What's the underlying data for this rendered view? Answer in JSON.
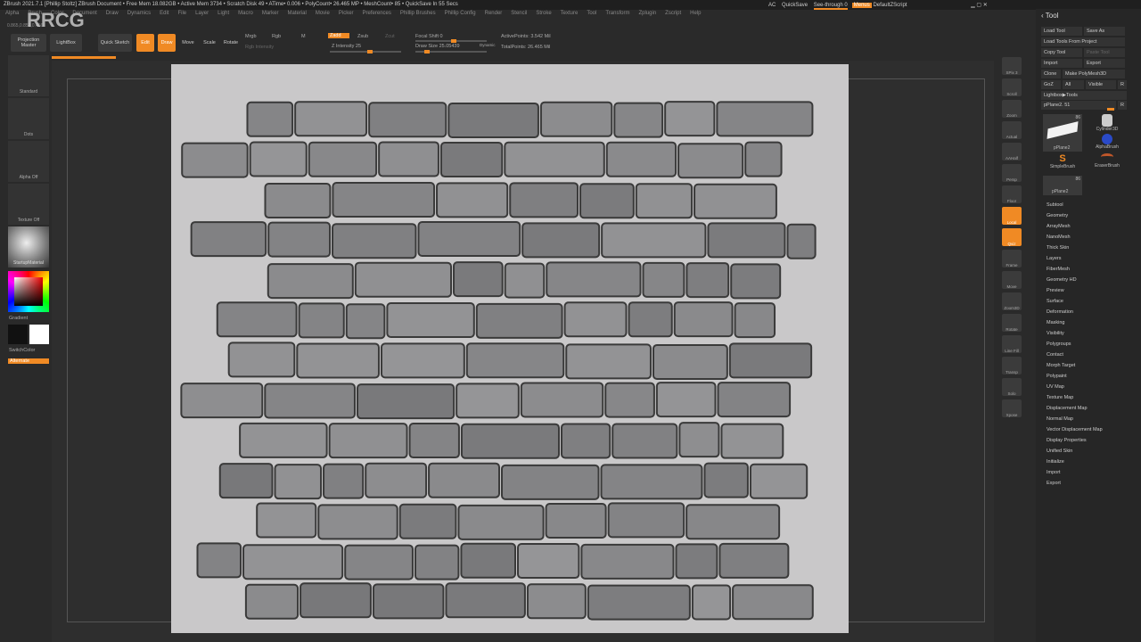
{
  "titlebar": {
    "text": "ZBrush 2021.7.1 [Phillip Stoltz]   ZBrush Document     • Free Mem 18.082GB • Active Mem 3734 • Scratch Disk 49 •  ATime• 0.006 • PolyCount• 26.465 MP  • MeshCount• 85  • QuickSave In 55 Secs",
    "right": {
      "ac": "AC",
      "quicksave": "QuickSave",
      "see_through": "See-through 0",
      "menus": "Menus",
      "script": "DefaultZScript"
    }
  },
  "menu": [
    "Alpha",
    "Brush",
    "Color",
    "Document",
    "Draw",
    "Dynamics",
    "Edit",
    "File",
    "Layer",
    "Light",
    "Macro",
    "Marker",
    "Material",
    "Movie",
    "Picker",
    "Preferences",
    "Phillip Brushes",
    "Phillip Config",
    "Render",
    "Stencil",
    "Stroke",
    "Texture",
    "Tool",
    "Transform",
    "Zplugin",
    "Zscript",
    "Help"
  ],
  "coords": "0.865,0.851,0.456",
  "toolbar": {
    "projection_master": "Projection Master",
    "lightbox": "LightBox",
    "quick_sketch": "Quick Sketch",
    "edit": "Edit",
    "draw": "Draw",
    "move": "Move",
    "scale": "Scale",
    "rotate": "Rotate",
    "mrgb": "Mrgb",
    "rgb": "Rgb",
    "m": "M",
    "rgb_intensity": "Rgb Intensity",
    "zadd": "Zadd",
    "zsub": "Zsub",
    "zcut": "Zcut",
    "z_intensity": "Z Intensity 25",
    "focal_shift": "Focal Shift 0",
    "draw_size": "Draw Size 25.05439",
    "dynamic": "Dynamic",
    "active_points": "ActivePoints: 3.542 Mil",
    "total_points": "TotalPoints: 26.465 Mil"
  },
  "leftshelf": {
    "brush": "Standard",
    "stroke": "Dots",
    "alpha": "Alpha Off",
    "texture": "Texture Off",
    "material": "StartupMaterial",
    "gradient": "Gradient",
    "switch_color": "SwitchColor",
    "alternate": "Alternate"
  },
  "rightshelf": [
    "SPix 3",
    "Scroll",
    "Zoom",
    "Actual",
    "AAHalf",
    "Persp",
    "Floor",
    "Local",
    "Qviz",
    "Frame",
    "Move",
    "Zoom3D",
    "Rotate",
    "Line Fill",
    "Transp",
    "Solo",
    "Xpose"
  ],
  "toolpanel": {
    "title": "Tool",
    "load_tool": "Load Tool",
    "save_as": "Save As",
    "load_from_project": "Load Tools From Project",
    "copy_tool": "Copy Tool",
    "paste_tool": "Paste Tool",
    "import": "Import",
    "export": "Export",
    "clone": "Clone",
    "make_polymesh": "Make PolyMesh3D",
    "goz": "GoZ",
    "all": "All",
    "visible": "Visible",
    "r": "R",
    "lightbox_tools": "Lightbox▶Tools",
    "current_tool": "pPlane2. 51",
    "thumbs": [
      "pPlane2",
      "Cylinder3D",
      "AlphaBrush",
      "SimpleBrush",
      "EraserBrush",
      "pPlane2"
    ],
    "thumb_count": "86",
    "subpalettes": [
      "Subtool",
      "Geometry",
      "ArrayMesh",
      "NanoMesh",
      "Thick Skin",
      "Layers",
      "FiberMesh",
      "Geometry HD",
      "Preview",
      "Surface",
      "Deformation",
      "Masking",
      "Visibility",
      "Polygroups",
      "Contact",
      "Morph Target",
      "Polypaint",
      "UV Map",
      "Texture Map",
      "Displacement Map",
      "Normal Map",
      "Vector Displacement Map",
      "Display Properties",
      "Unified Skin",
      "Initialize",
      "Import",
      "Export"
    ]
  },
  "watermark": "RRCG",
  "colors": {
    "accent": "#f08a24",
    "bg": "#2a2a2a"
  }
}
